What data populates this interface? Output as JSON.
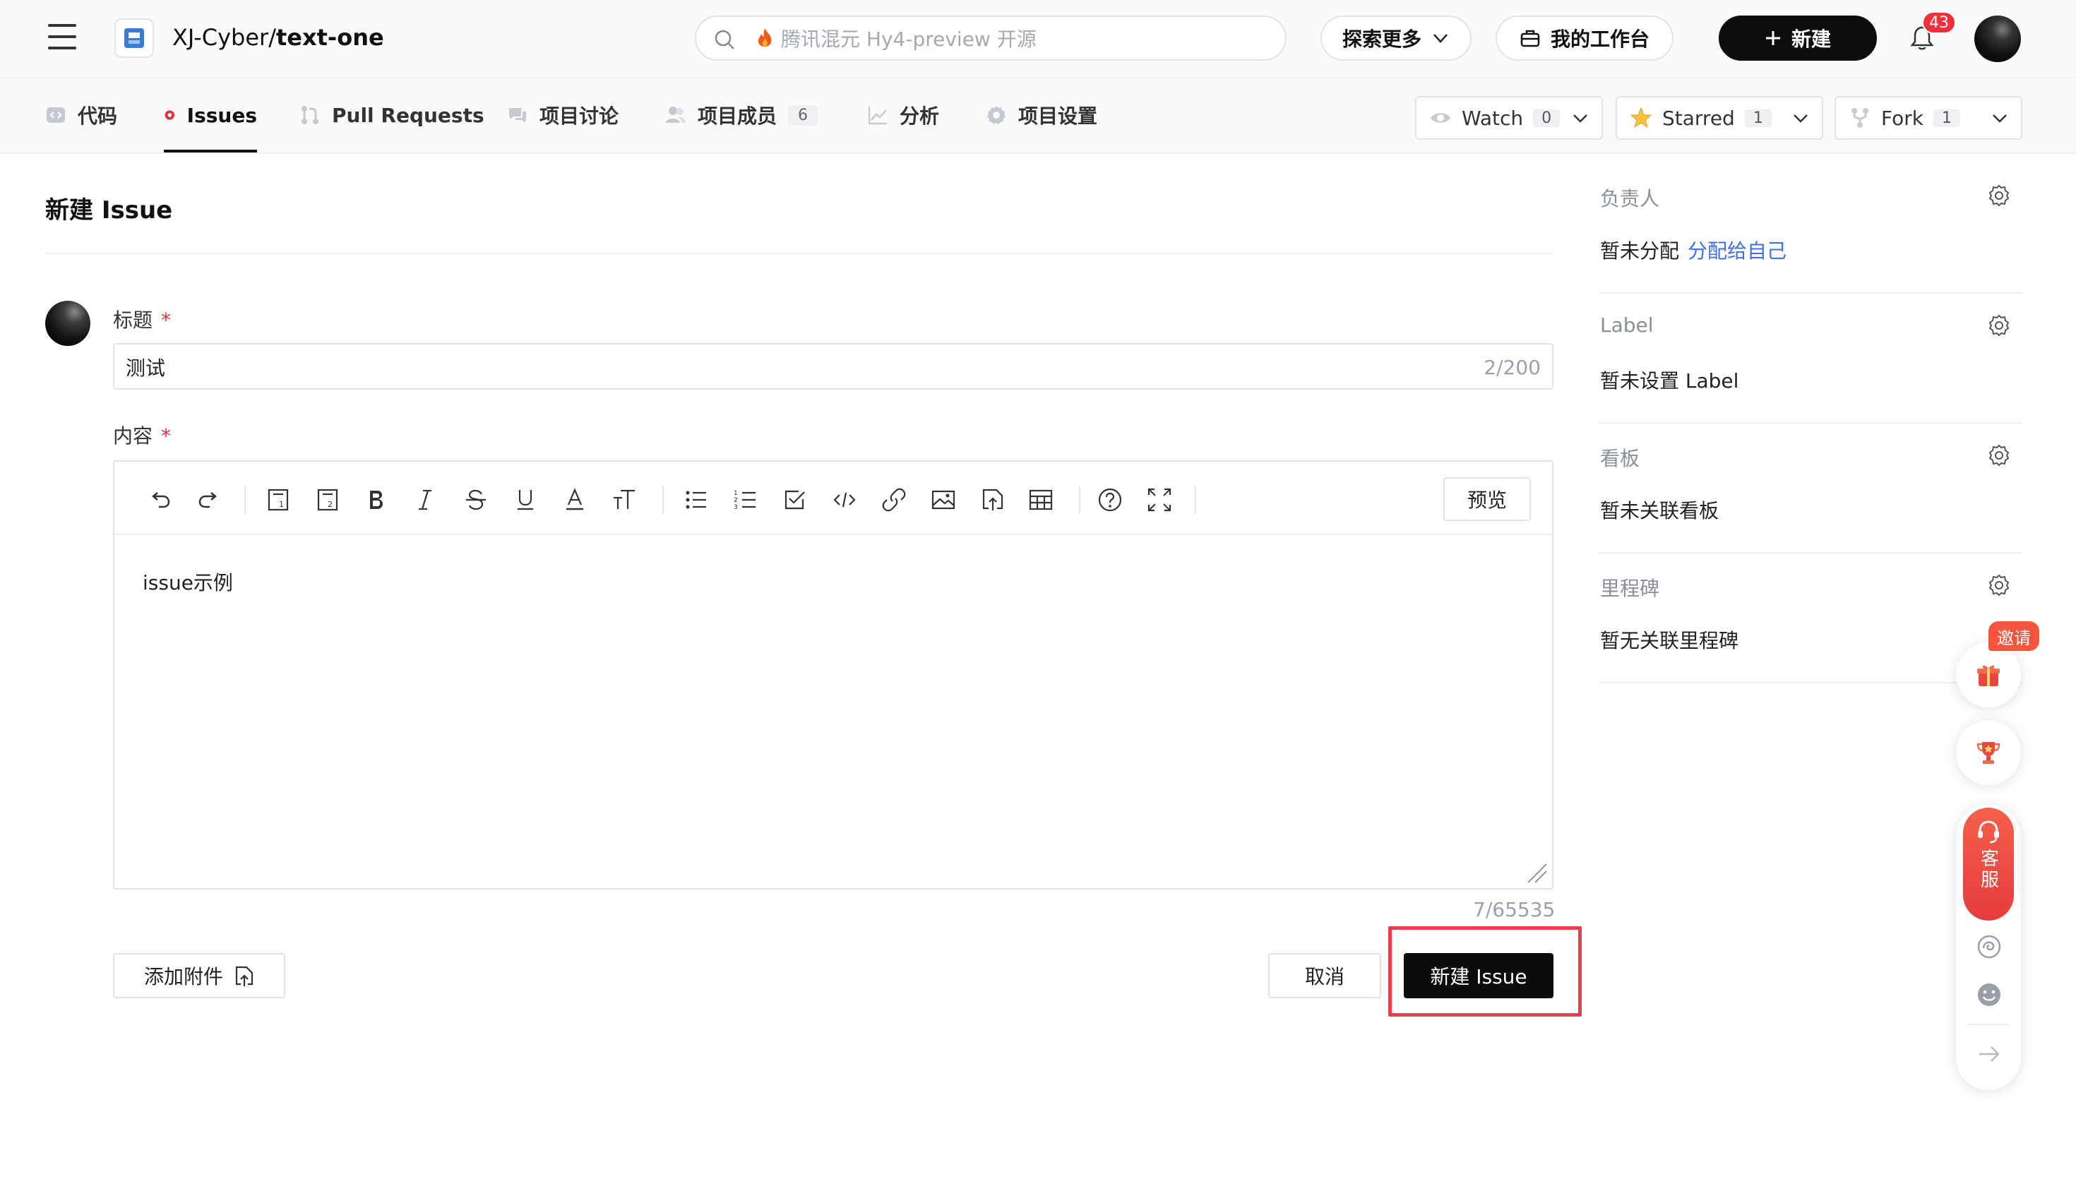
{
  "header": {
    "repo_owner": "XJ-Cyber",
    "repo_separator": "/",
    "repo_name": "text-one",
    "search_placeholder": "腾讯混元 Hy4-preview 开源",
    "explore_label": "探索更多",
    "workbench_label": "我的工作台",
    "new_label": "新建",
    "notification_count": "43"
  },
  "tabs": [
    {
      "label": "代码"
    },
    {
      "label": "Issues"
    },
    {
      "label": "Pull Requests"
    },
    {
      "label": "项目讨论"
    },
    {
      "label": "项目成员",
      "count": "6"
    },
    {
      "label": "分析"
    },
    {
      "label": "项目设置"
    }
  ],
  "repo_actions": {
    "watch_label": "Watch",
    "watch_count": "0",
    "star_label": "Starred",
    "star_count": "1",
    "fork_label": "Fork",
    "fork_count": "1"
  },
  "form": {
    "page_title": "新建 Issue",
    "title_label": "标题",
    "required_mark": "*",
    "title_value": "测试",
    "title_counter": "2/200",
    "content_label": "内容",
    "preview_label": "预览",
    "content_value": "issue示例",
    "content_counter": "7/65535",
    "attach_label": "添加附件",
    "cancel_label": "取消",
    "submit_label": "新建 Issue"
  },
  "sidebar": {
    "assignee_title": "负责人",
    "assignee_value": "暂未分配",
    "assign_self_link": "分配给自己",
    "label_title": "Label",
    "label_value": "暂未设置 Label",
    "board_title": "看板",
    "board_value": "暂未关联看板",
    "milestone_title": "里程碑",
    "milestone_value": "暂无关联里程碑"
  },
  "floating": {
    "invite_label": "邀请",
    "support_label": "客服"
  },
  "colors": {
    "accent_link": "#3e6fe8",
    "required": "#e5303b",
    "primary_button": "#0b0c0e",
    "highlight_box": "#e8404a",
    "badge": "#f22e3a"
  }
}
